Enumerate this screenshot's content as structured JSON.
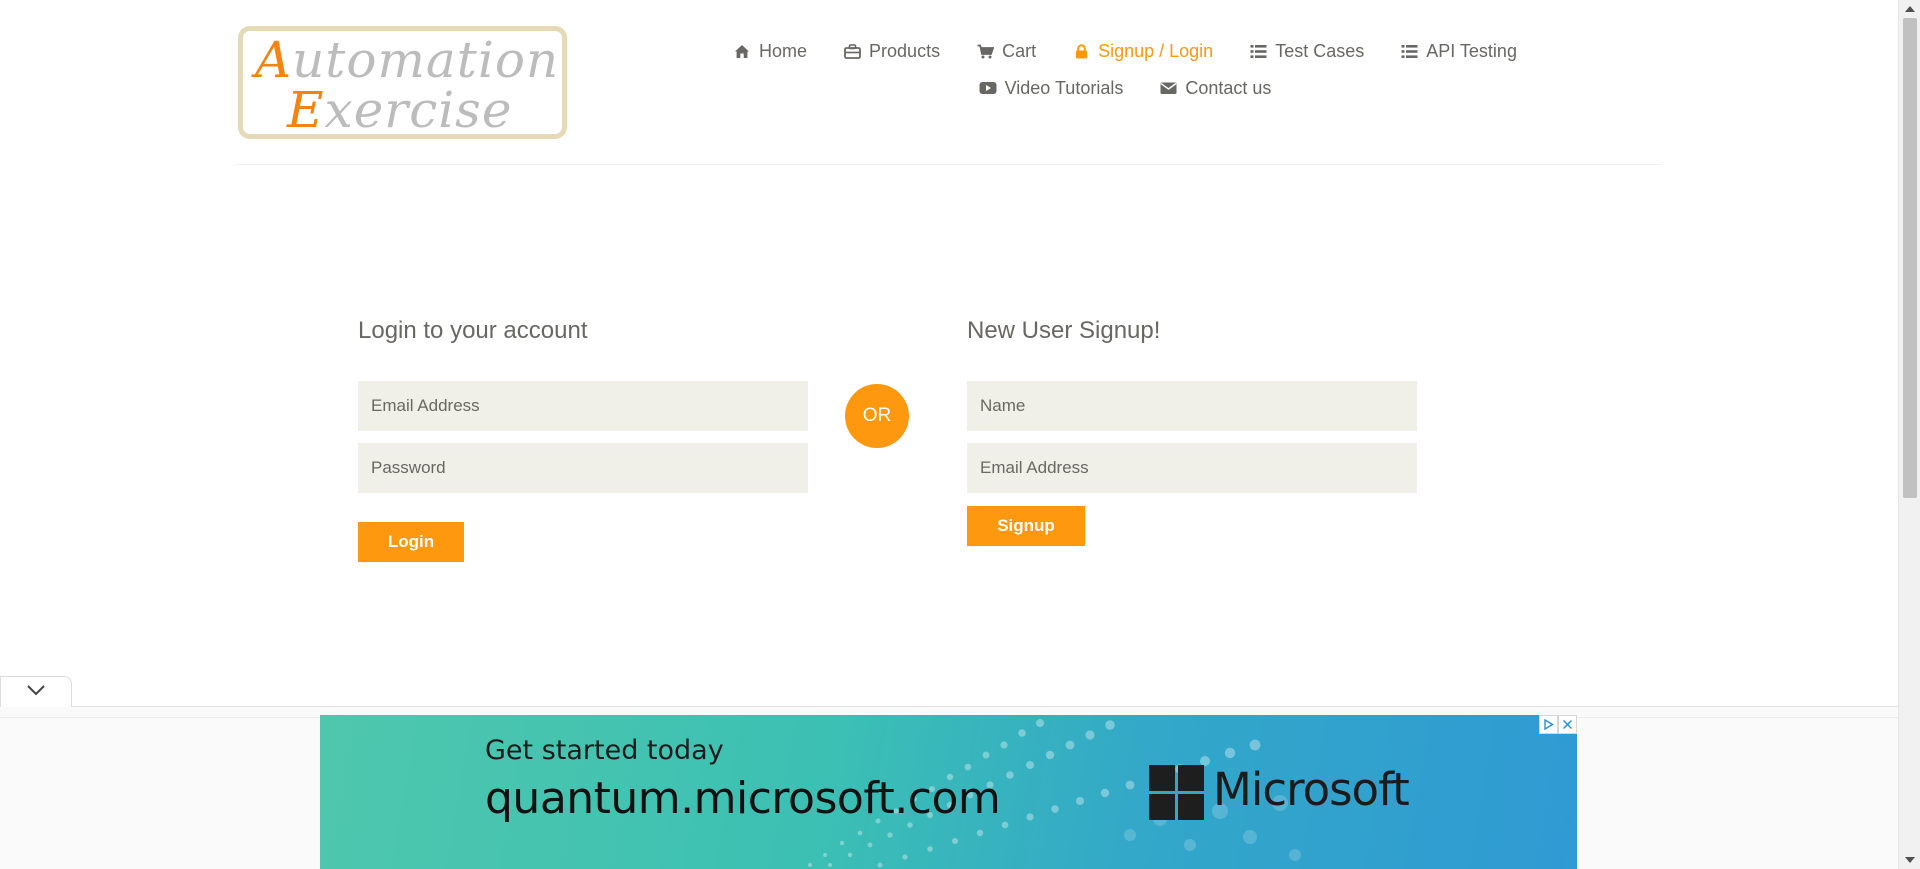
{
  "header": {
    "logo": {
      "line1_cap": "A",
      "line1_rest": "utomation",
      "line2_cap": "E",
      "line2_rest": "xercise"
    },
    "nav_row1": [
      {
        "label": "Home",
        "icon": "home-icon"
      },
      {
        "label": "Products",
        "icon": "products-icon"
      },
      {
        "label": "Cart",
        "icon": "cart-icon"
      },
      {
        "label": "Signup / Login",
        "icon": "lock-icon",
        "active": true
      },
      {
        "label": "Test Cases",
        "icon": "list-icon"
      },
      {
        "label": "API Testing",
        "icon": "list-icon"
      }
    ],
    "nav_row2": [
      {
        "label": "Video Tutorials",
        "icon": "youtube-icon"
      },
      {
        "label": "Contact us",
        "icon": "envelope-icon"
      }
    ],
    "active_color": "#fe980f",
    "text_color": "#696763"
  },
  "login": {
    "title": "Login to your account",
    "email_placeholder": "Email Address",
    "password_placeholder": "Password",
    "button_label": "Login"
  },
  "or_label": "OR",
  "signup": {
    "title": "New User Signup!",
    "name_placeholder": "Name",
    "email_placeholder": "Email Address",
    "button_label": "Signup"
  },
  "ad": {
    "headline": "Get started today",
    "domain": "quantum.microsoft.com",
    "brand": "Microsoft",
    "toggle_icon": "chevron-down-icon",
    "choices_icons": [
      "adchoices-icon",
      "close-icon"
    ]
  },
  "colors": {
    "accent": "#fe980f",
    "field_bg": "#f0f0e9",
    "ad_gradient_start": "#4fc7ad",
    "ad_gradient_end": "#2f9ad3"
  }
}
